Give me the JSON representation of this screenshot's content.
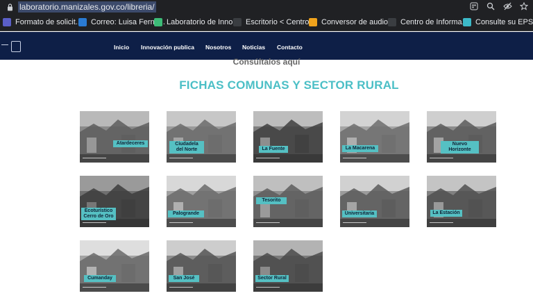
{
  "browser": {
    "url": "laboratorio.manizales.gov.co/libreria/",
    "bookmarks": [
      {
        "label": "Formato de solicit...",
        "color": "#5b5fc7"
      },
      {
        "label": "Correo: Luisa Ferna...",
        "color": "#2a7bd3"
      },
      {
        "label": "Laboratorio de Inno...",
        "color": "#3dbb77"
      },
      {
        "label": "Escritorio < Centro...",
        "color": "#3a3d41"
      },
      {
        "label": "Conversor de audio...",
        "color": "#f0a31c"
      },
      {
        "label": "Centro de Informa...",
        "color": "#3a3d41"
      },
      {
        "label": "Consulte su EPS",
        "color": "#3cb9c8"
      }
    ]
  },
  "nav": {
    "links": [
      "Inicio",
      "Innovación publica",
      "Nosotros",
      "Noticias",
      "Contacto"
    ]
  },
  "main": {
    "subheading": "Consúltalos aquí",
    "heading": "FICHAS COMUNAS Y SECTOR RURAL",
    "accent": "#4bbfc6",
    "cards": [
      {
        "label": "Atardeceres"
      },
      {
        "label": "Ciudadela del Norte"
      },
      {
        "label": "La Fuente"
      },
      {
        "label": "La Macarena"
      },
      {
        "label": "Nuevo Horizonte"
      },
      {
        "label": "Ecoturístico Cerro de Oro"
      },
      {
        "label": "Palogrande"
      },
      {
        "label": "Tesorito"
      },
      {
        "label": "Universitaria"
      },
      {
        "label": "La Estación"
      },
      {
        "label": "Cumanday"
      },
      {
        "label": "San José"
      },
      {
        "label": "Sector Rural"
      }
    ]
  }
}
